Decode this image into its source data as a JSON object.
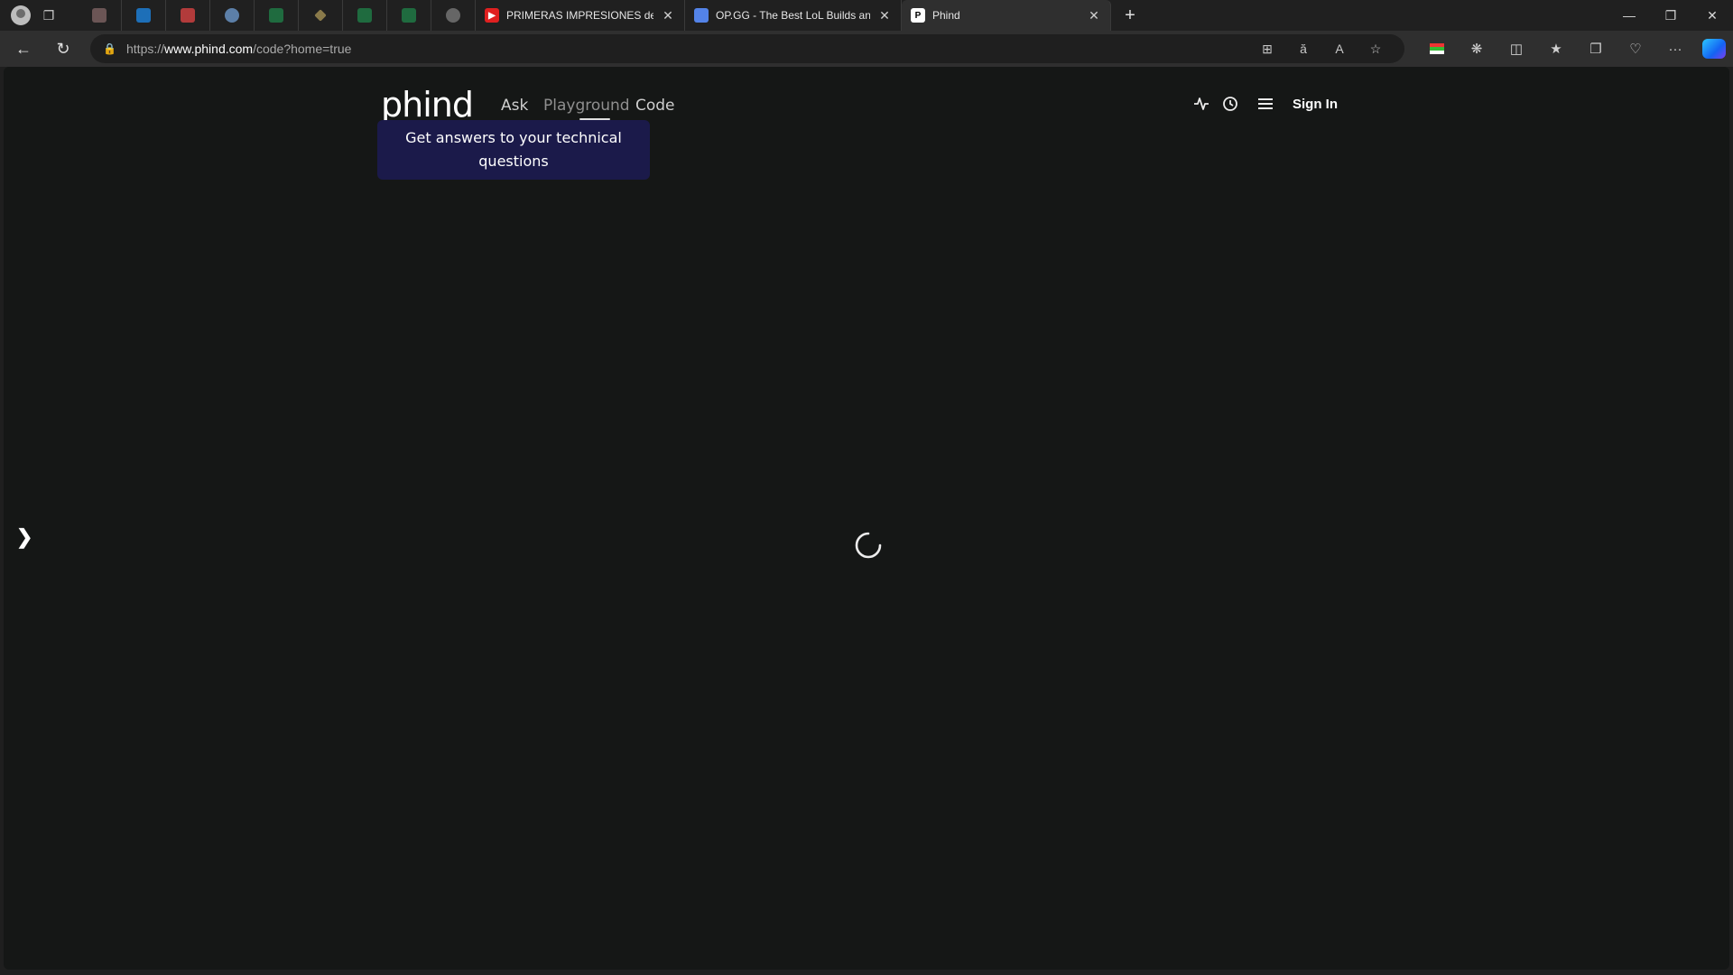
{
  "browser": {
    "tabs": [
      {
        "title": "PRIMERAS IMPRESIONES de K",
        "favicon": "youtube-icon"
      },
      {
        "title": "OP.GG - The Best LoL Builds and",
        "favicon": "opgg-icon"
      },
      {
        "title": "Phind",
        "favicon": "phind-icon",
        "active": true
      }
    ],
    "new_tab_label": "+",
    "address": {
      "prefix": "https://",
      "host": "www.phind.com",
      "path": "/code?home=true"
    }
  },
  "page": {
    "logo": "phind",
    "nav": {
      "ask": "Ask",
      "playground": "Playground",
      "code": "Code"
    },
    "tooltip": "Get answers to your technical questions",
    "sign_in": "Sign In"
  },
  "colors": {
    "page_bg": "#151716",
    "tooltip_bg": "#1b1a4a",
    "accent": "#2cc7ff"
  }
}
